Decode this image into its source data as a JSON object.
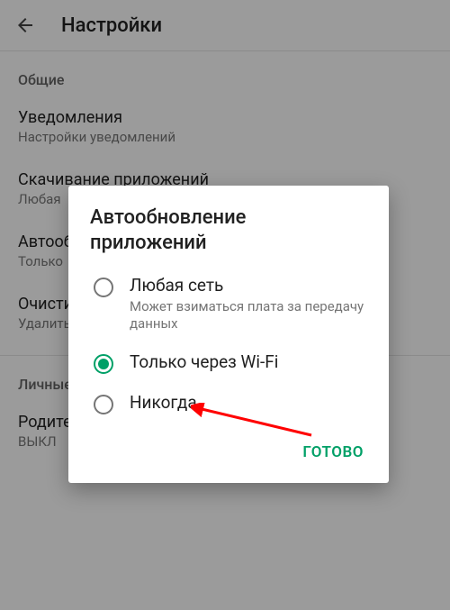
{
  "header": {
    "title": "Настройки"
  },
  "sections": {
    "general": {
      "label": "Общие",
      "items": [
        {
          "title": "Уведомления",
          "subtitle": "Настройки уведомлений"
        },
        {
          "title": "Скачивание приложений",
          "subtitle": "Любая"
        },
        {
          "title": "Автообновление приложений",
          "subtitle": "Только"
        },
        {
          "title": "Очистить историю поиска",
          "subtitle": "Удалить все поисковые запросы с этого устройства"
        }
      ]
    },
    "personal": {
      "label": "Личные",
      "items": [
        {
          "title": "Родительский контроль",
          "subtitle": "ВЫКЛ"
        }
      ]
    }
  },
  "dialog": {
    "title": "Автообновление приложений",
    "options": [
      {
        "label": "Любая сеть",
        "sublabel": "Может взиматься плата за передачу данных",
        "selected": false
      },
      {
        "label": "Только через Wi-Fi",
        "sublabel": "",
        "selected": true
      },
      {
        "label": "Никогда",
        "sublabel": "",
        "selected": false
      }
    ],
    "done": "ГОТОВО"
  },
  "colors": {
    "accent": "#00a067"
  }
}
